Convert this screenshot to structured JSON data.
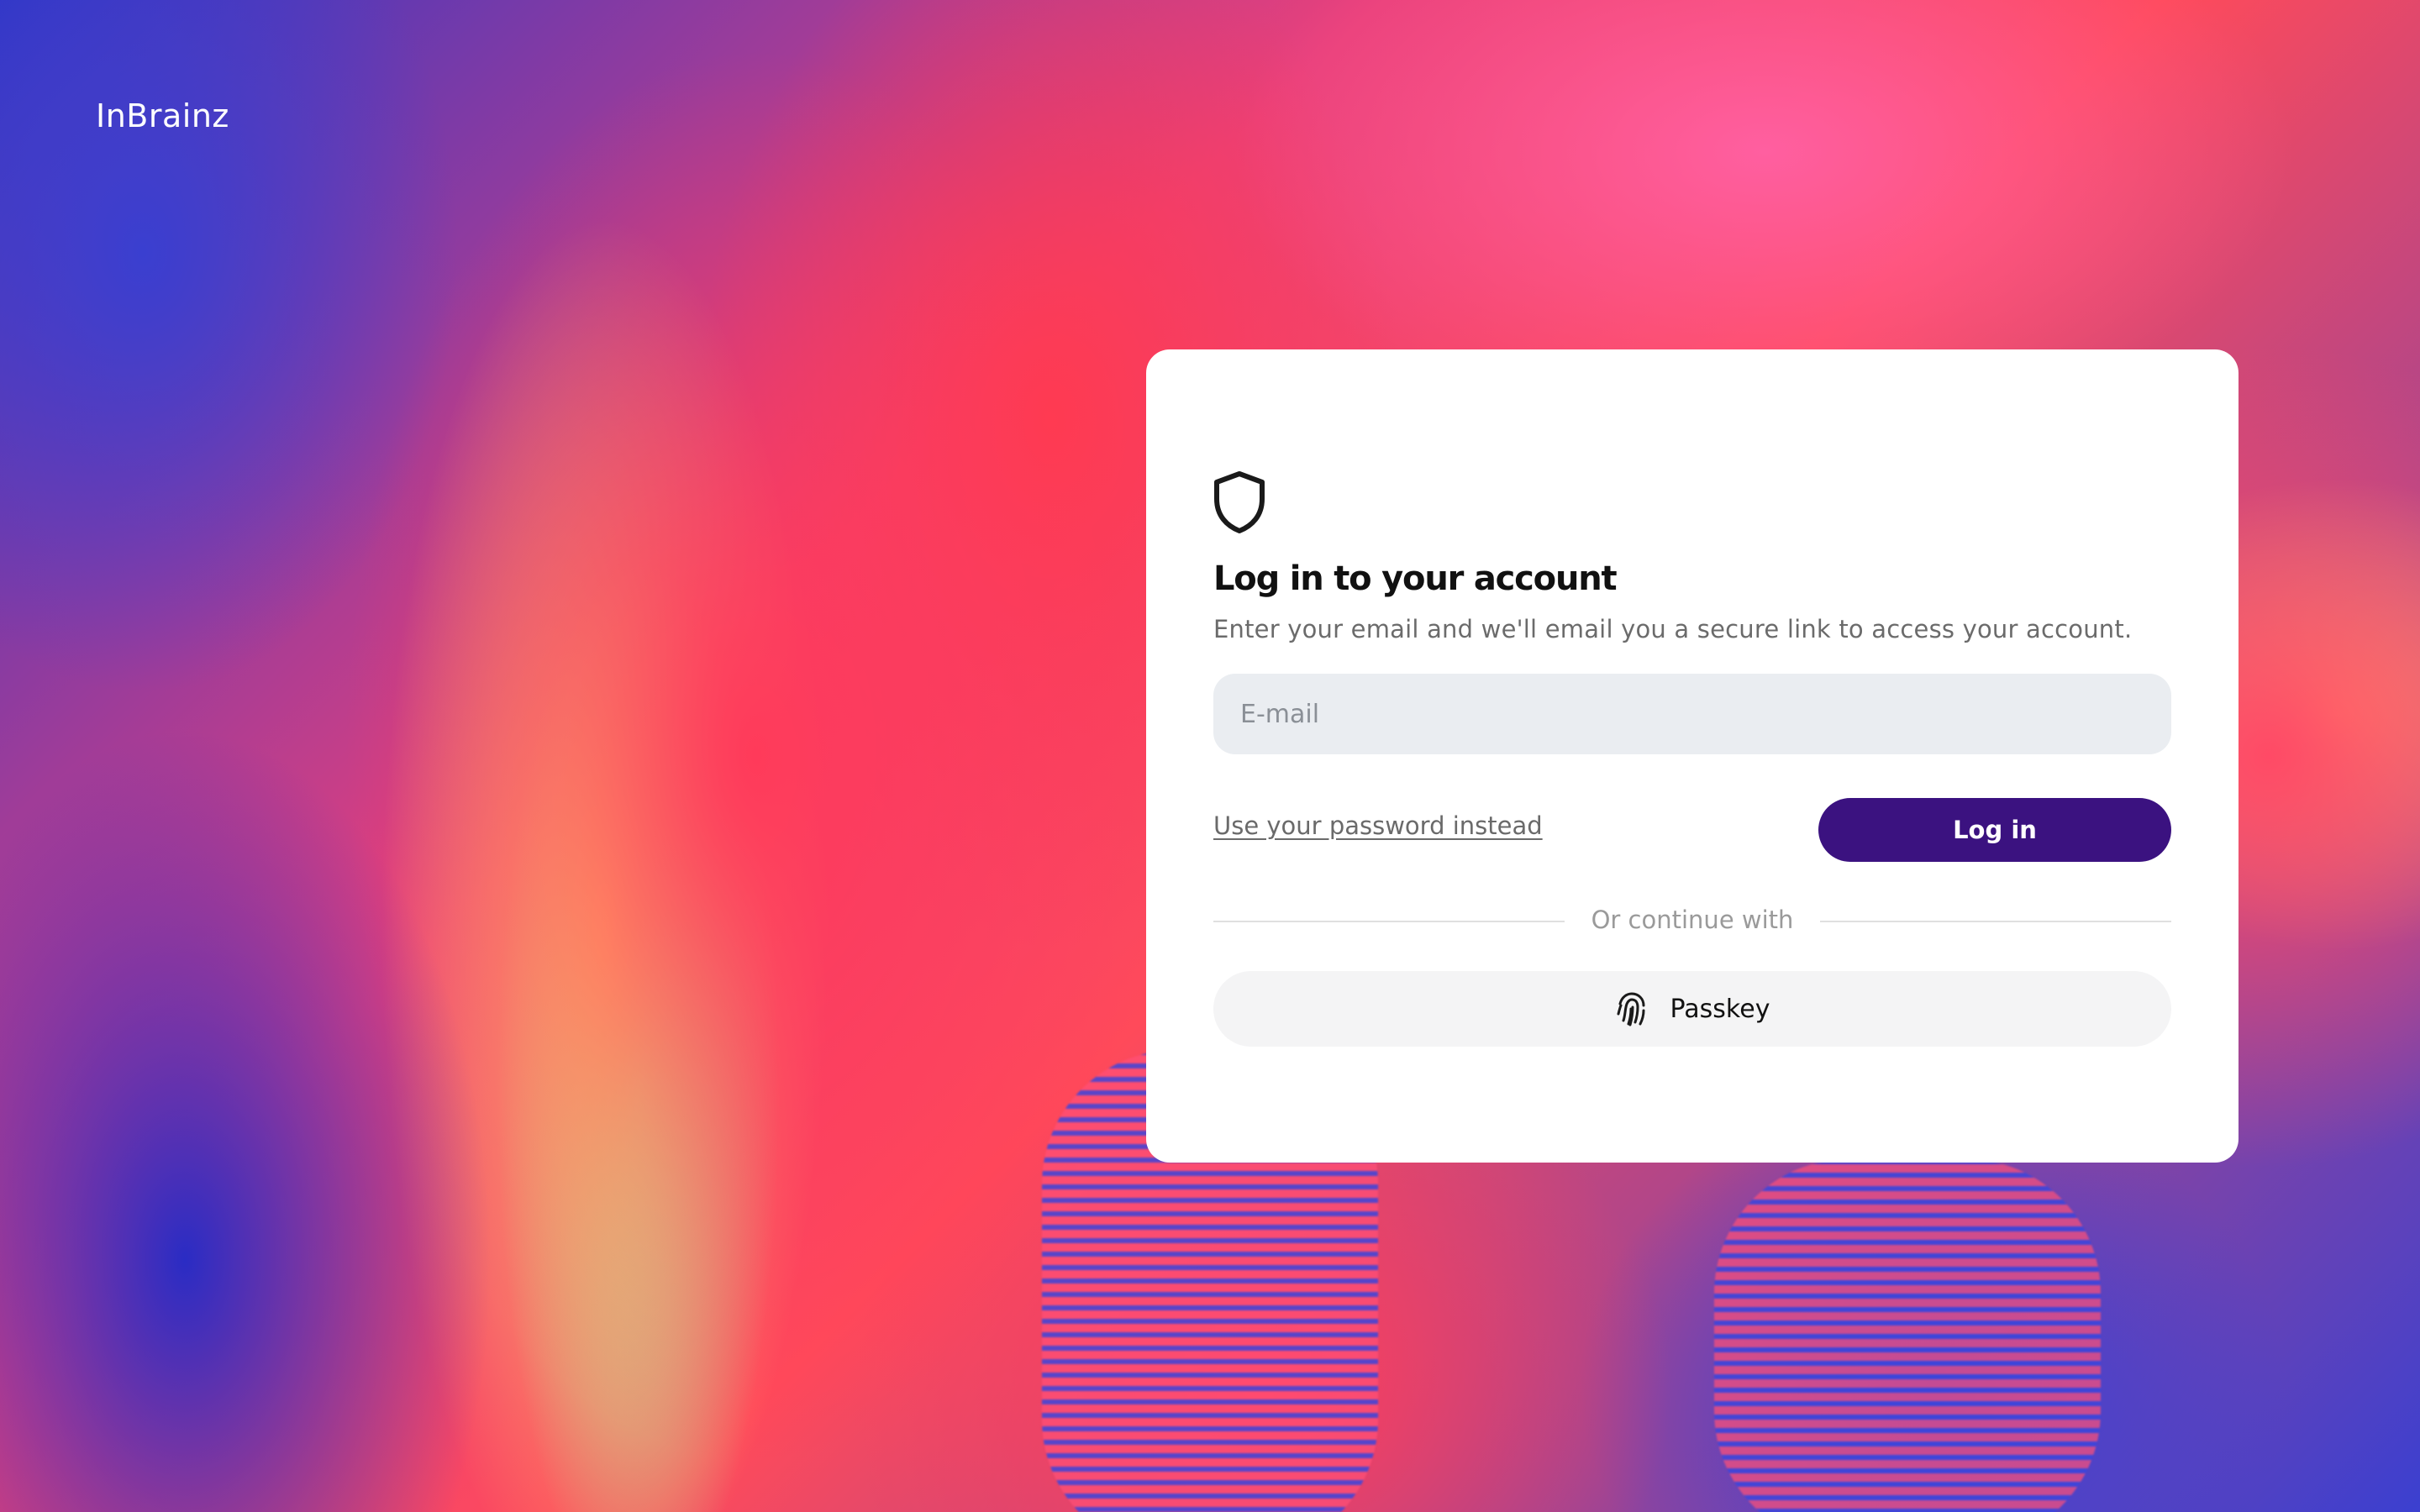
{
  "brand": {
    "name": "InBrainz"
  },
  "login": {
    "icon": "shield-icon",
    "title": "Log in to your account",
    "subtitle": "Enter your email and we'll email you a secure link to access your account.",
    "email_placeholder": "E-mail",
    "email_value": "",
    "password_link": "Use your password instead",
    "login_button": "Log in",
    "divider_text": "Or continue with",
    "passkey_button": "Passkey",
    "passkey_icon": "fingerprint-icon"
  },
  "colors": {
    "primary_button": "#3b1280",
    "input_background": "#eaedf1",
    "card_background": "#ffffff"
  }
}
